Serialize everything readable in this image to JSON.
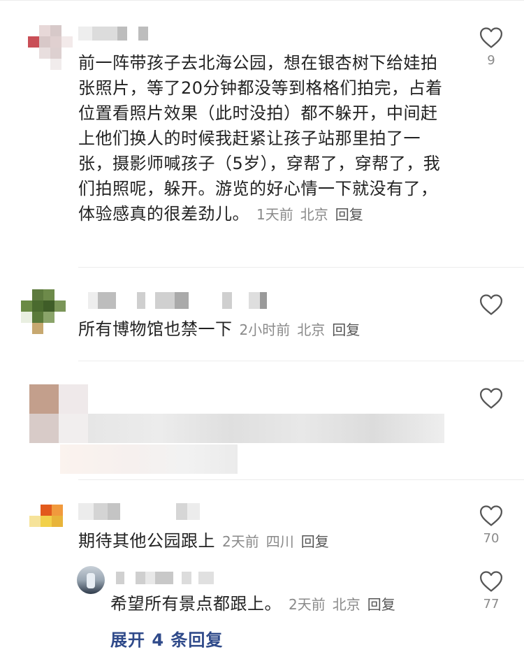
{
  "comments": [
    {
      "text": "前一阵带孩子去北海公园，想在银杏树下给娃拍张照片，等了20分钟都没等到格格们拍完，占着位置看照片效果（此时没拍）都不躲开，中间赶上他们换人的时候我赶紧让孩子站那里拍了一张，摄影师喊孩子（5岁），穿帮了，穿帮了，我们拍照呢，躲开。游览的好心情一下就没有了，体验感真的很差劲儿。",
      "time": "1天前",
      "location": "北京",
      "reply": "回复",
      "likes": "9"
    },
    {
      "text": "所有博物馆也禁一下",
      "time": "2小时前",
      "location": "北京",
      "reply": "回复",
      "likes": ""
    },
    {
      "text": "",
      "likes": ""
    },
    {
      "text": "期待其他公园跟上",
      "time": "2天前",
      "location": "四川",
      "reply": "回复",
      "likes": "70"
    }
  ],
  "reply": {
    "text": "希望所有景点都跟上。",
    "time": "2天前",
    "location": "北京",
    "reply": "回复",
    "likes": "77"
  },
  "expand_label": "展开 4 条回复",
  "icons": {
    "like": "heart-outline-icon"
  },
  "colors": {
    "link": "#2f4a8a",
    "meta": "#8a8a8a",
    "heart": "#555555"
  }
}
